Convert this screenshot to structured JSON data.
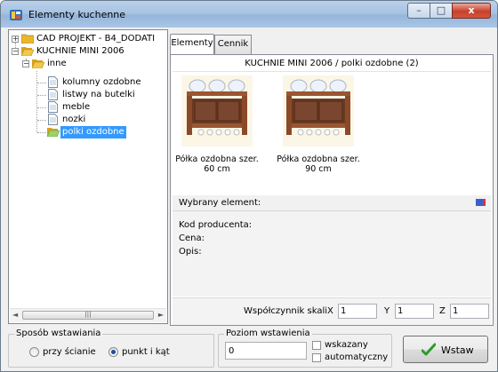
{
  "window": {
    "title": "Elementy kuchenne",
    "minimize_glyph": "–",
    "maximize_glyph": "□",
    "close_glyph": "x"
  },
  "tree": {
    "nodes": [
      {
        "label": "CAD PROJEKT - B4_DODATI",
        "expander": "+"
      },
      {
        "label": "KUCHNIE MINI 2006",
        "expander": "−"
      },
      {
        "label": "inne",
        "expander": "−"
      },
      {
        "label": "kolumny ozdobne"
      },
      {
        "label": "listwy na butelki"
      },
      {
        "label": "meble"
      },
      {
        "label": "nozki"
      },
      {
        "label": "polki ozdobne",
        "selected": true
      }
    ],
    "scroll_left": "◄",
    "scroll_right": "►",
    "scroll_grip": "|||"
  },
  "tabs": [
    {
      "label": "Elementy",
      "active": true
    },
    {
      "label": "Cennik",
      "active": false
    }
  ],
  "catalog": {
    "title": "KUCHNIE MINI 2006 / polki ozdobne (2)",
    "products": [
      {
        "name_line1": "Półka ozdobna szer.",
        "name_line2": "60 cm"
      },
      {
        "name_line1": "Półka ozdobna szer.",
        "name_line2": "90 cm"
      }
    ]
  },
  "selected_element": {
    "header": "Wybrany element:",
    "producer_code_label": "Kod producenta:",
    "price_label": "Cena:",
    "description_label": "Opis:"
  },
  "scale": {
    "label": "Współczynnik skali",
    "x_label": "X",
    "x_value": "1",
    "y_label": "Y",
    "y_value": "1",
    "z_label": "Z",
    "z_value": "1"
  },
  "insertion_method": {
    "legend": "Sposób wstawiania",
    "option_wall": "przy ścianie",
    "option_point": "punkt i kąt",
    "selected": "punkt i kąt"
  },
  "insertion_level": {
    "legend": "Poziom wstawienia",
    "value": "0",
    "checkbox_indicated": "wskazany",
    "checkbox_automatic": "automatyczny"
  },
  "insert_button": {
    "label": "Wstaw"
  },
  "colors": {
    "selection": "#3399ff",
    "wood": "#8a4a2a",
    "close_button": "#c7402b",
    "checkmark": "#2e9a2e"
  }
}
